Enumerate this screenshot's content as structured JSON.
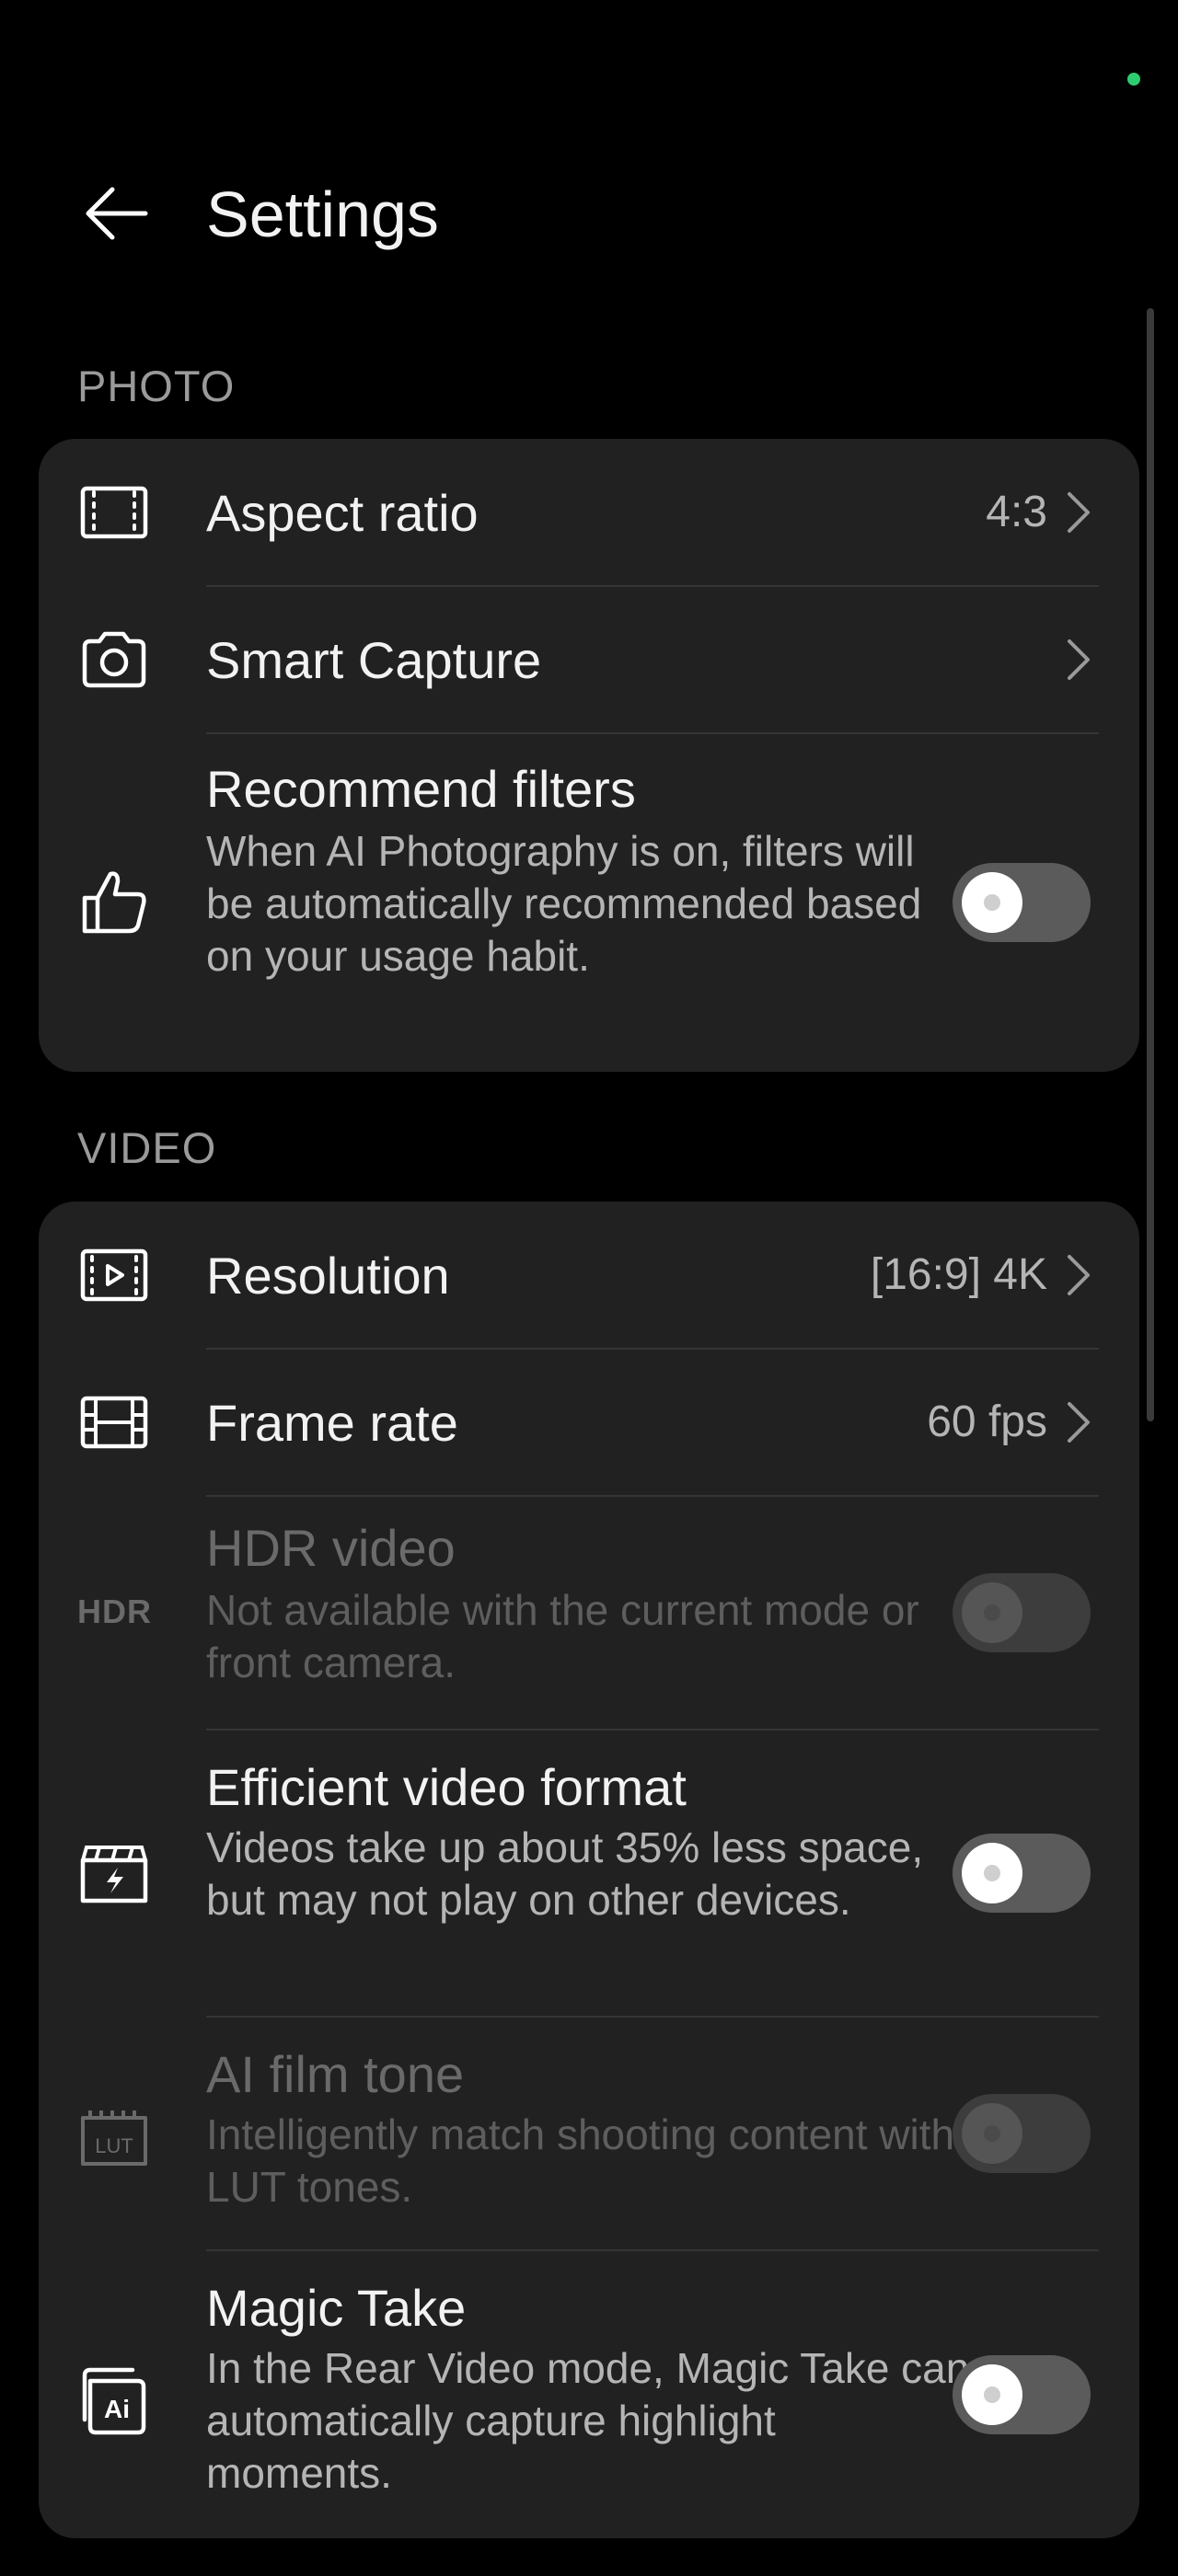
{
  "header": {
    "title": "Settings"
  },
  "photo": {
    "section_label": "PHOTO",
    "aspect_ratio": {
      "label": "Aspect ratio",
      "value": "4:3"
    },
    "smart_capture": {
      "label": "Smart Capture"
    },
    "recommend_filters": {
      "label": "Recommend filters",
      "description": "When AI Photography is on, filters will be automatically recommended based on your usage habit.",
      "enabled": false
    }
  },
  "video": {
    "section_label": "VIDEO",
    "resolution": {
      "label": "Resolution",
      "value": "[16:9] 4K"
    },
    "frame_rate": {
      "label": "Frame rate",
      "value": "60 fps"
    },
    "hdr_video": {
      "icon_text": "HDR",
      "label": "HDR video",
      "description": "Not available with the current mode or front camera.",
      "enabled": false,
      "disabled": true
    },
    "efficient_format": {
      "label": "Efficient video format",
      "description": "Videos take up about 35% less space, but may not play on other devices.",
      "enabled": false
    },
    "ai_film_tone": {
      "icon_text": "LUT",
      "label": "AI film tone",
      "description": "Intelligently match shooting content with LUT tones.",
      "enabled": false,
      "disabled": true
    },
    "magic_take": {
      "icon_text": "Ai",
      "label": "Magic Take",
      "description": "In the Rear Video mode, Magic Take can automatically capture highlight moments.",
      "enabled": false
    }
  },
  "colors": {
    "background": "#000000",
    "card": "#212121",
    "status_dot": "#2ecc71"
  }
}
